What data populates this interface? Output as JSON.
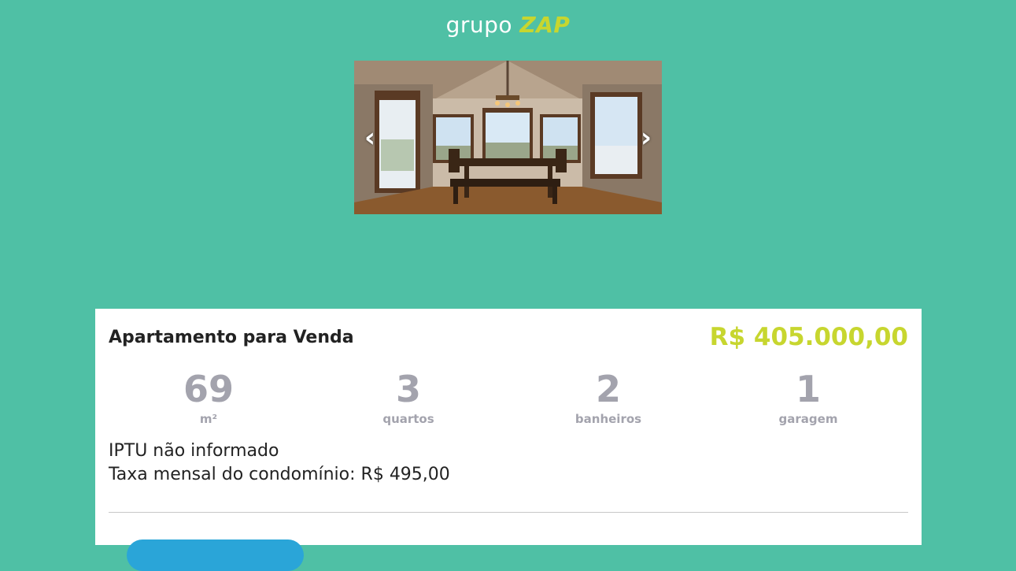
{
  "logo": {
    "part1": "grupo",
    "part2": "ZAP"
  },
  "carousel": {
    "prev_icon": "‹",
    "next_icon": "›",
    "image_subject": "dining room with wooden table and large windows"
  },
  "listing": {
    "title": "Apartamento para Venda",
    "price": "R$ 405.000,00",
    "features": [
      {
        "value": "69",
        "label": "m²"
      },
      {
        "value": "3",
        "label": "quartos"
      },
      {
        "value": "2",
        "label": "banheiros"
      },
      {
        "value": "1",
        "label": "garagem"
      }
    ],
    "iptu": "IPTU não informado",
    "condo_fee": "Taxa mensal do condomínio: R$ 495,00"
  },
  "colors": {
    "background": "#4fc0a5",
    "accent": "#c7d62f",
    "muted": "#a3a3ad",
    "button": "#2aa5d8"
  }
}
